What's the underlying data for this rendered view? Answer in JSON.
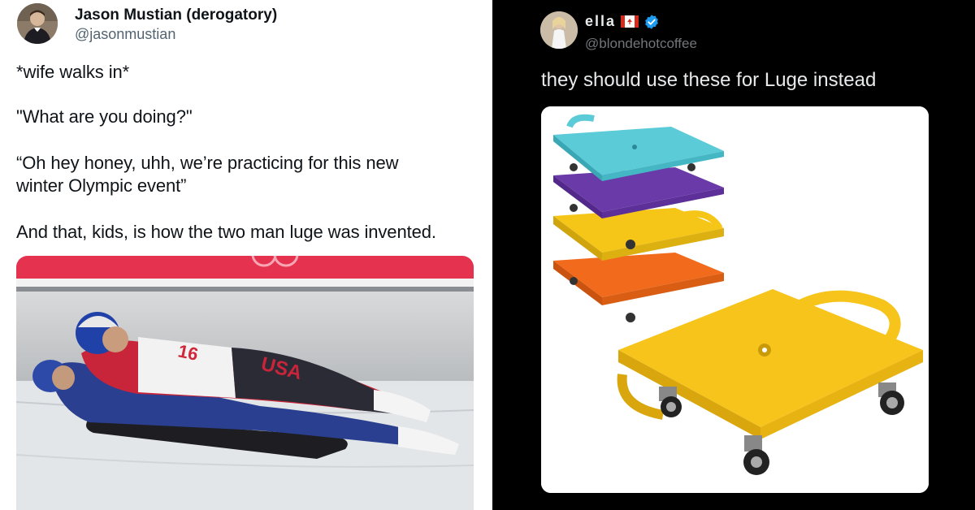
{
  "left_tweet": {
    "author_name": "Jason Mustian (derogatory)",
    "handle": "@jasonmustian",
    "lines": [
      "*wife walks in*",
      "\"What are you doing?\"",
      "“Oh hey honey, uhh, we’re practicing for this new",
      "winter Olympic event”",
      "And that, kids, is how the two man luge was invented."
    ],
    "media": {
      "bib_number": "16",
      "suit_letters": "USA"
    }
  },
  "right_tweet": {
    "author_name": "ella",
    "handle": "@blondehotcoffee",
    "text": "they should use these for Luge instead",
    "flag_icon": "canada-flag-icon",
    "verified_icon": "verified-badge-icon",
    "colors": {
      "accent_blue": "#1d9bf0",
      "board_cyan": "#5ccbd8",
      "board_purple": "#6a3aa8",
      "board_yellow": "#f5c518",
      "board_orange": "#f26b1d"
    }
  }
}
